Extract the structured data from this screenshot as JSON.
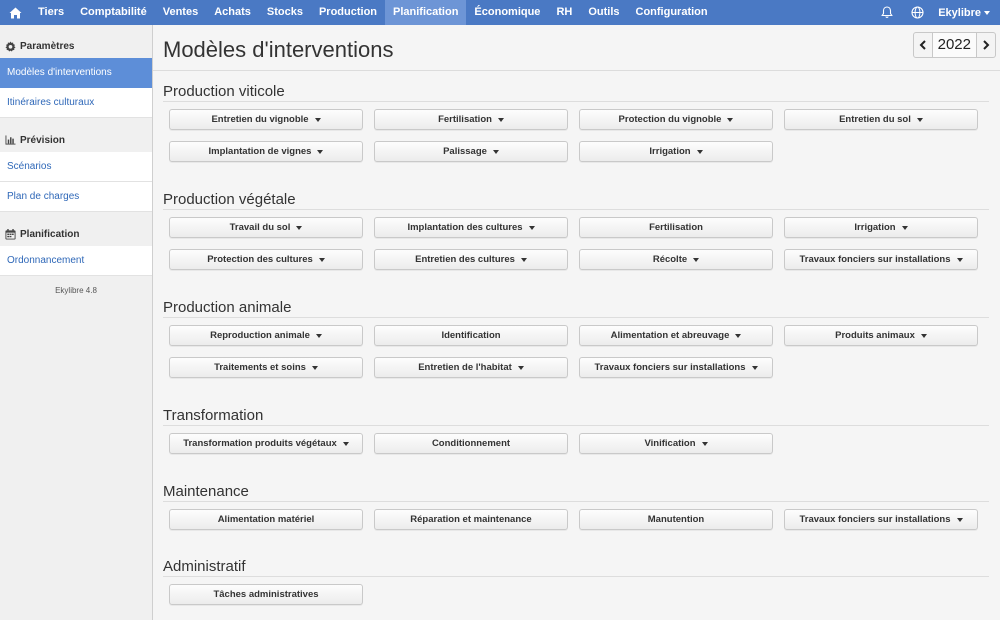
{
  "nav": {
    "items": [
      "Tiers",
      "Comptabilité",
      "Ventes",
      "Achats",
      "Stocks",
      "Production",
      "Planification",
      "Économique",
      "RH",
      "Outils",
      "Configuration"
    ],
    "active": "Planification",
    "user": "Ekylibre"
  },
  "sidebar": {
    "groups": [
      {
        "title": "Paramètres",
        "icon": "gear-icon",
        "links": [
          "Modèles d'interventions",
          "Itinéraires culturaux"
        ]
      },
      {
        "title": "Prévision",
        "icon": "bar-chart-icon",
        "links": [
          "Scénarios",
          "Plan de charges"
        ]
      },
      {
        "title": "Planification",
        "icon": "calendar-icon",
        "links": [
          "Ordonnancement"
        ]
      }
    ],
    "active_link": "Modèles d'interventions",
    "version": "Ekylibre 4.8"
  },
  "page": {
    "title": "Modèles d'interventions",
    "year": "2022"
  },
  "sections": [
    {
      "title": "Production viticole",
      "buttons": [
        {
          "label": "Entretien du vignoble",
          "dropdown": true
        },
        {
          "label": "Fertilisation",
          "dropdown": true
        },
        {
          "label": "Protection du vignoble",
          "dropdown": true
        },
        {
          "label": "Entretien du sol",
          "dropdown": true
        },
        {
          "label": "Implantation de vignes",
          "dropdown": true
        },
        {
          "label": "Palissage",
          "dropdown": true
        },
        {
          "label": "Irrigation",
          "dropdown": true
        }
      ]
    },
    {
      "title": "Production végétale",
      "buttons": [
        {
          "label": "Travail du sol",
          "dropdown": true
        },
        {
          "label": "Implantation des cultures",
          "dropdown": true
        },
        {
          "label": "Fertilisation",
          "dropdown": false
        },
        {
          "label": "Irrigation",
          "dropdown": true
        },
        {
          "label": "Protection des cultures",
          "dropdown": true
        },
        {
          "label": "Entretien des cultures",
          "dropdown": true
        },
        {
          "label": "Récolte",
          "dropdown": true
        },
        {
          "label": "Travaux fonciers sur installations",
          "dropdown": true
        }
      ]
    },
    {
      "title": "Production animale",
      "buttons": [
        {
          "label": "Reproduction animale",
          "dropdown": true
        },
        {
          "label": "Identification",
          "dropdown": false
        },
        {
          "label": "Alimentation et abreuvage",
          "dropdown": true
        },
        {
          "label": "Produits animaux",
          "dropdown": true
        },
        {
          "label": "Traitements et soins",
          "dropdown": true
        },
        {
          "label": "Entretien de l'habitat",
          "dropdown": true
        },
        {
          "label": "Travaux fonciers sur installations",
          "dropdown": true
        }
      ]
    },
    {
      "title": "Transformation",
      "buttons": [
        {
          "label": "Transformation produits végétaux",
          "dropdown": true
        },
        {
          "label": "Conditionnement",
          "dropdown": false
        },
        {
          "label": "Vinification",
          "dropdown": true
        }
      ]
    },
    {
      "title": "Maintenance",
      "buttons": [
        {
          "label": "Alimentation matériel",
          "dropdown": false
        },
        {
          "label": "Réparation et maintenance",
          "dropdown": false
        },
        {
          "label": "Manutention",
          "dropdown": false
        },
        {
          "label": "Travaux fonciers sur installations",
          "dropdown": true
        }
      ]
    },
    {
      "title": "Administratif",
      "buttons": [
        {
          "label": "Tâches administratives",
          "dropdown": false
        }
      ]
    }
  ],
  "colors": {
    "navbar": "#4a79c4",
    "nav_active": "#6d95d6",
    "sidebar_active": "#5d8ed8",
    "link": "#2f68b8"
  }
}
